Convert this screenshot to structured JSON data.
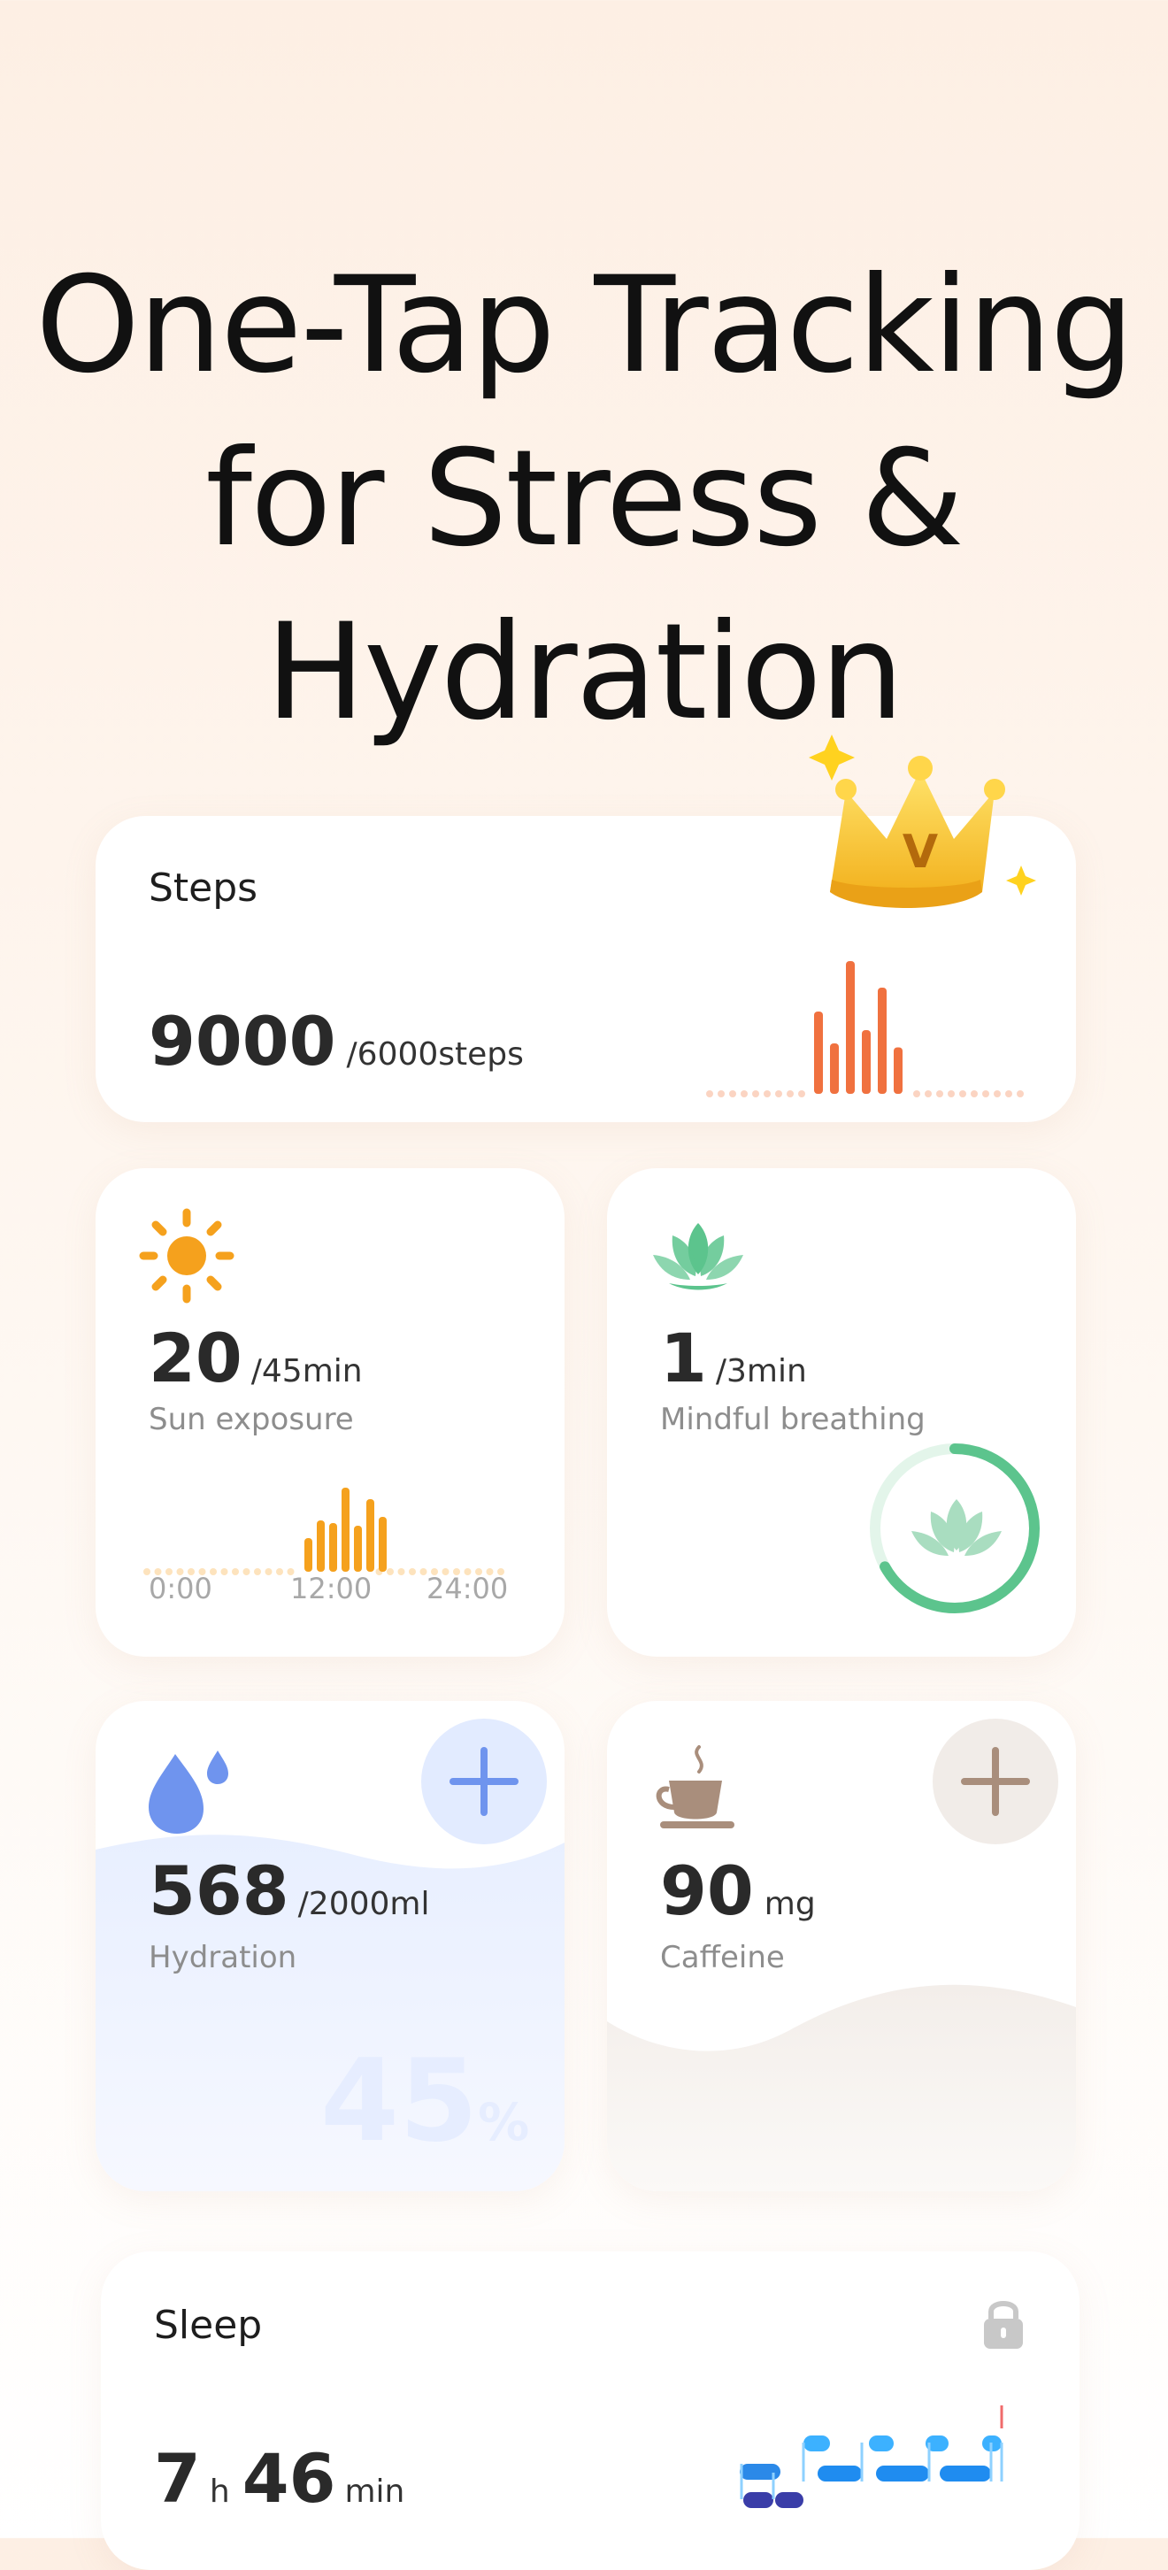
{
  "headline": {
    "line1": "One-Tap Tracking",
    "line2": "for Stress &",
    "line3": "Hydration"
  },
  "steps": {
    "title": "Steps",
    "value": "9000",
    "goal": "/6000steps",
    "bars": [
      0.62,
      0.38,
      1.0,
      0.48,
      0.8,
      0.35
    ],
    "color": "#f0713f",
    "icon": "crown-icon",
    "badge_letter": "V"
  },
  "sun": {
    "value": "20",
    "goal": "/45min",
    "label": "Sun exposure",
    "bars": [
      0.38,
      0.58,
      0.55,
      0.95,
      0.52,
      0.82,
      0.62
    ],
    "x_ticks": [
      "0:00",
      "12:00",
      "24:00"
    ],
    "color": "#f5a11d",
    "icon": "sun-icon"
  },
  "breathing": {
    "value": "1",
    "goal": "/3min",
    "label": "Mindful breathing",
    "progress": 0.67,
    "color": "#5cc48d",
    "icon": "lotus-icon"
  },
  "hydration": {
    "value": "568",
    "goal": "/2000ml",
    "label": "Hydration",
    "percent": "45",
    "percent_sign": "%",
    "color": "#6f94ee",
    "icon": "water-drop-icon"
  },
  "caffeine": {
    "value": "90",
    "unit": "mg",
    "label": "Caffeine",
    "color": "#a98e7c",
    "icon": "coffee-cup-icon"
  },
  "sleep": {
    "title": "Sleep",
    "hours": "7",
    "hours_unit": "h",
    "minutes": "46",
    "minutes_unit": "min",
    "icon": "lock-icon"
  }
}
